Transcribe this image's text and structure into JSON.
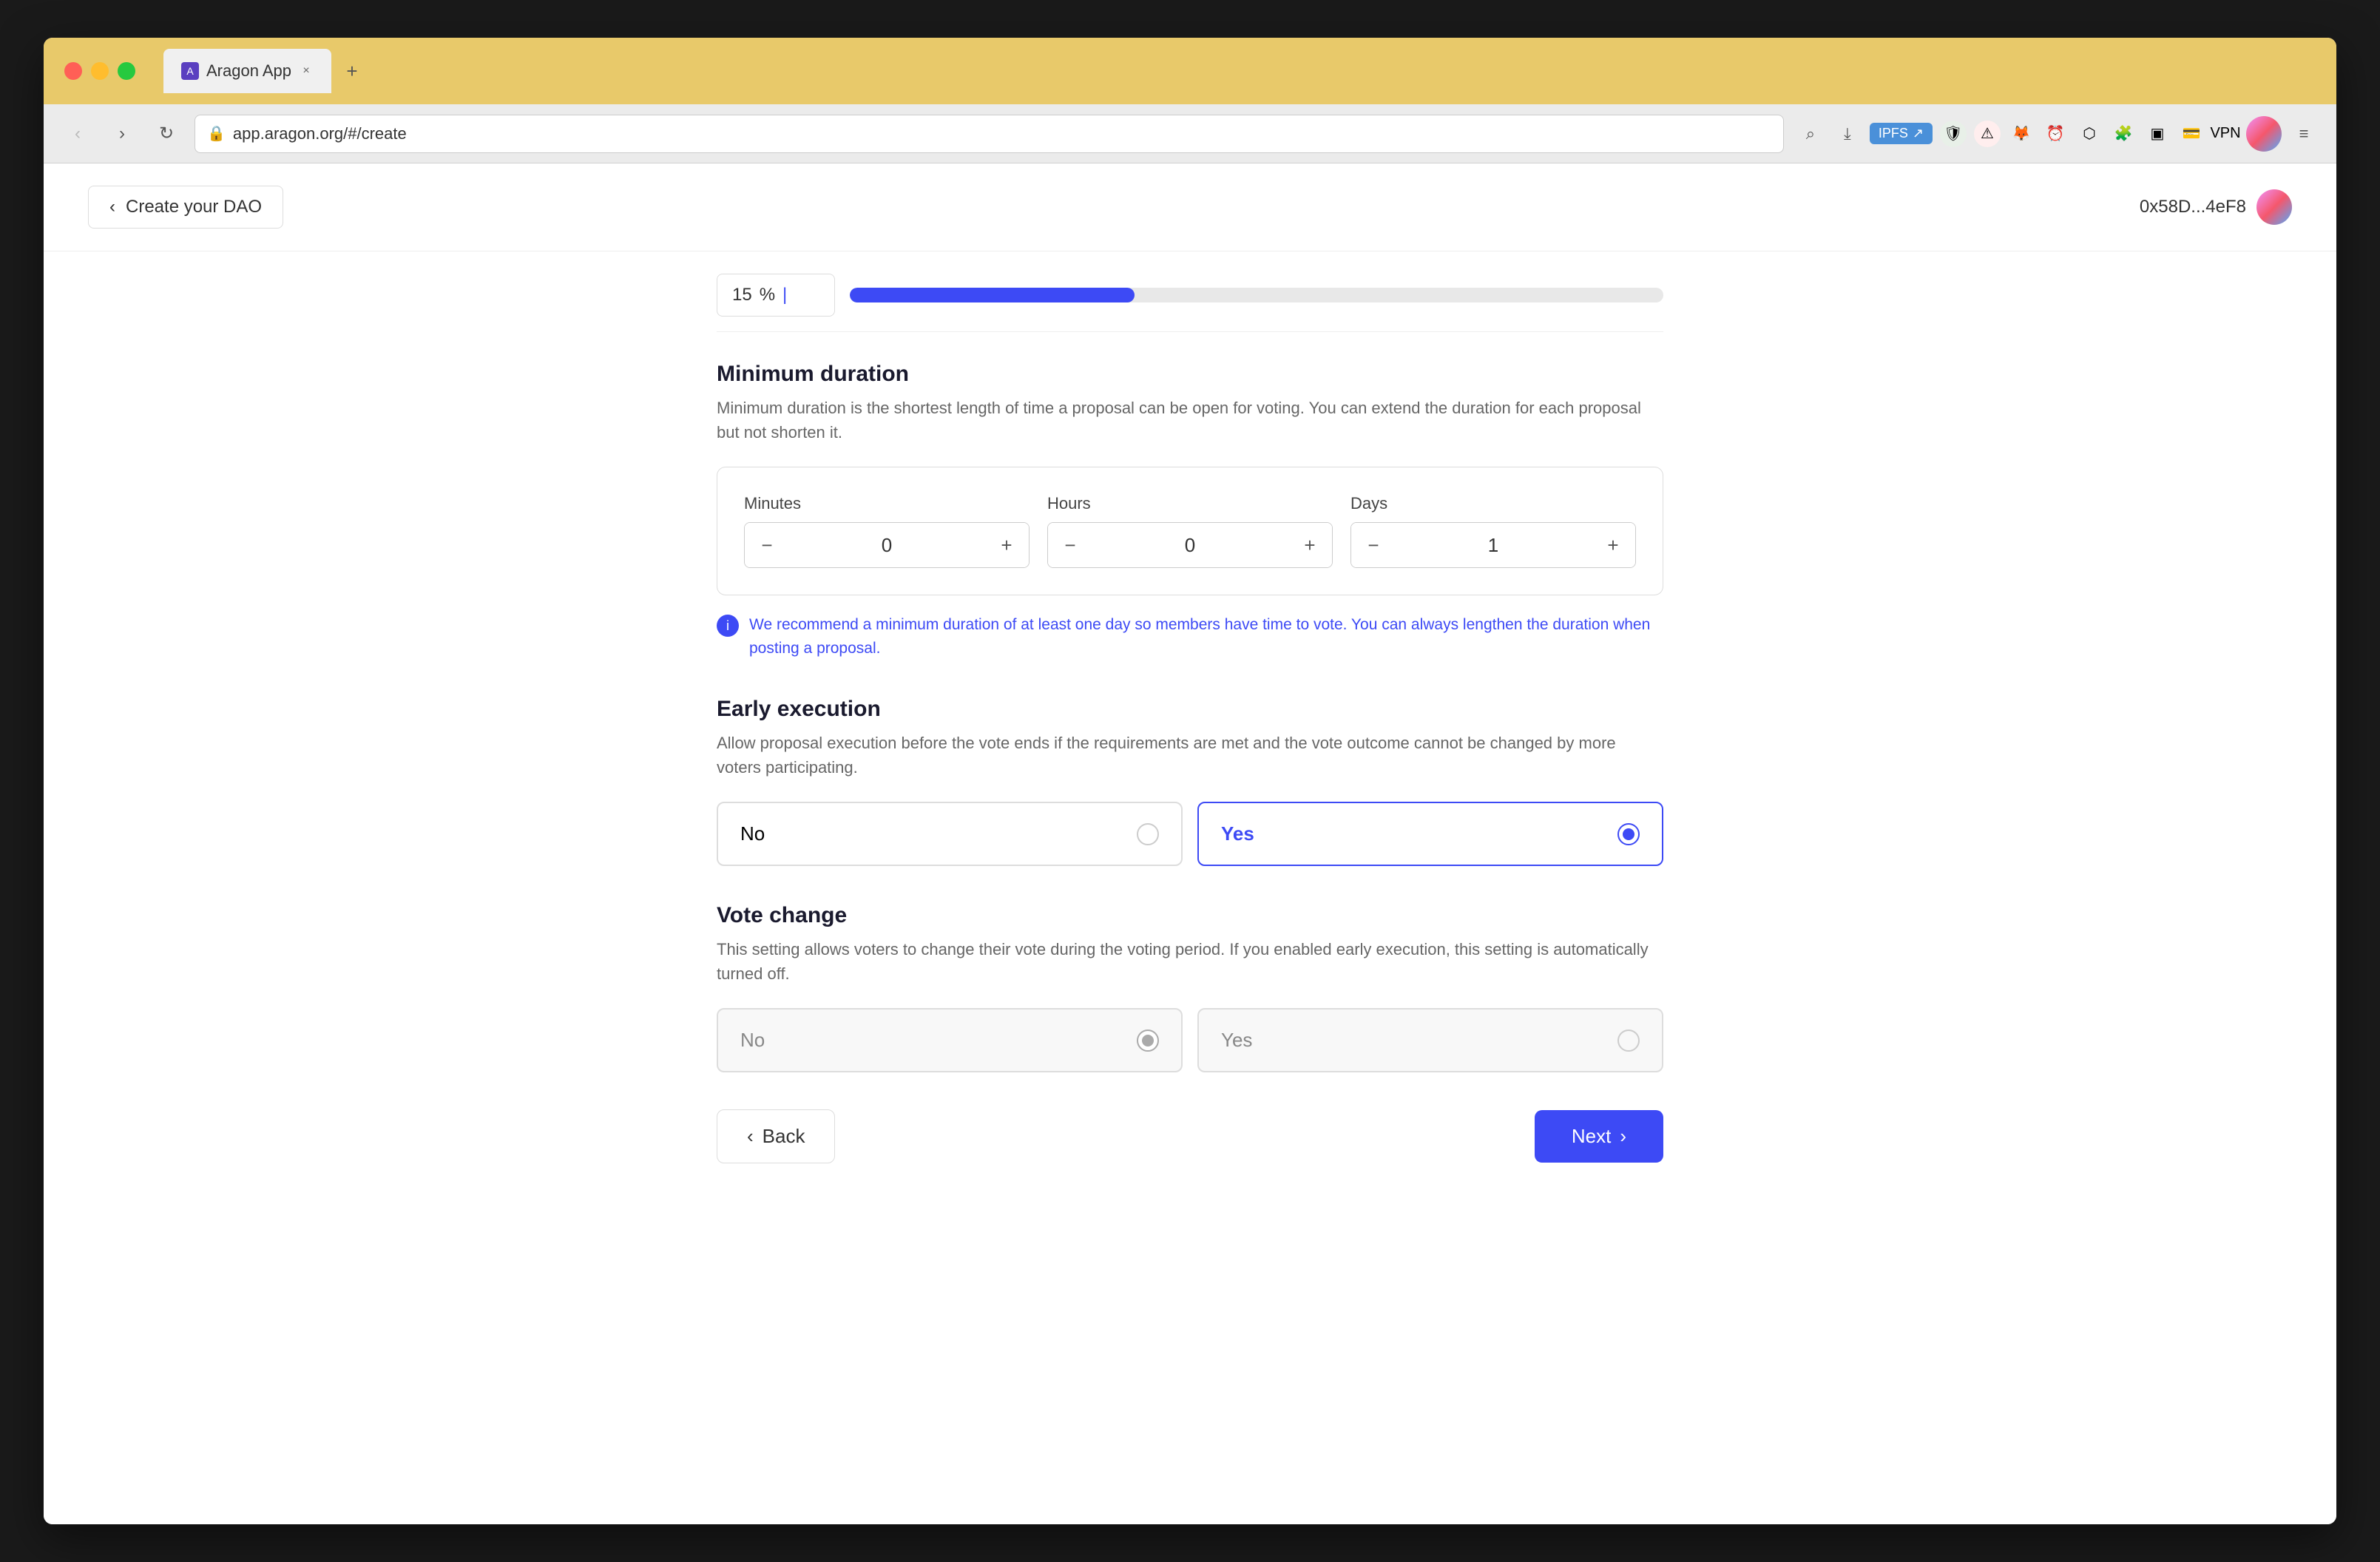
{
  "browser": {
    "tab_title": "Aragon App",
    "url": "app.aragon.org/#/create",
    "new_tab_symbol": "+",
    "close_symbol": "×"
  },
  "header": {
    "back_label": "Create your DAO",
    "wallet_address": "0x58D...4eF8"
  },
  "progress": {
    "value": "15",
    "unit": "%",
    "fill_width": "35%"
  },
  "minimum_duration": {
    "title": "Minimum duration",
    "description": "Minimum duration is the shortest length of time a proposal can be open for voting. You can extend the duration for each proposal but not shorten it.",
    "fields": [
      {
        "label": "Minutes",
        "value": "0"
      },
      {
        "label": "Hours",
        "value": "0"
      },
      {
        "label": "Days",
        "value": "1"
      }
    ],
    "info_text": "We recommend a minimum duration of at least one day so members have time to vote. You can always lengthen the duration when posting a proposal."
  },
  "early_execution": {
    "title": "Early execution",
    "description": "Allow proposal execution before the vote ends if the requirements are met and the vote outcome cannot be changed by more voters participating.",
    "options": [
      {
        "label": "No",
        "selected": false
      },
      {
        "label": "Yes",
        "selected": true
      }
    ]
  },
  "vote_change": {
    "title": "Vote change",
    "description": "This setting allows voters to change their vote during the voting period. If you enabled early execution, this setting is automatically turned off.",
    "options": [
      {
        "label": "No",
        "selected": true
      },
      {
        "label": "Yes",
        "selected": false
      }
    ]
  },
  "navigation": {
    "back_label": "Back",
    "next_label": "Next",
    "back_chevron": "‹",
    "next_chevron": "›"
  },
  "icons": {
    "back": "‹",
    "forward": "›",
    "reload": "↻",
    "bookmark": "⊡",
    "lock": "🔒",
    "search": "⌕",
    "download": "⤓",
    "info": "i"
  }
}
